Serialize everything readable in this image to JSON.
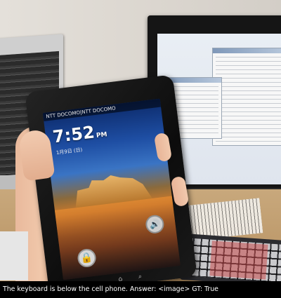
{
  "tablet": {
    "carrier": "NTT DOCOMO|NTT DOCOMO",
    "time": "7:52",
    "ampm": "PM",
    "date": "1月9日 (日)",
    "unlock_icon": "lock-icon",
    "sound_icon": "speaker-icon",
    "nav_keys": "⌂ ⌕"
  },
  "caption": {
    "text": "The keyboard is below the cell phone. Answer: <image>  GT: True"
  }
}
